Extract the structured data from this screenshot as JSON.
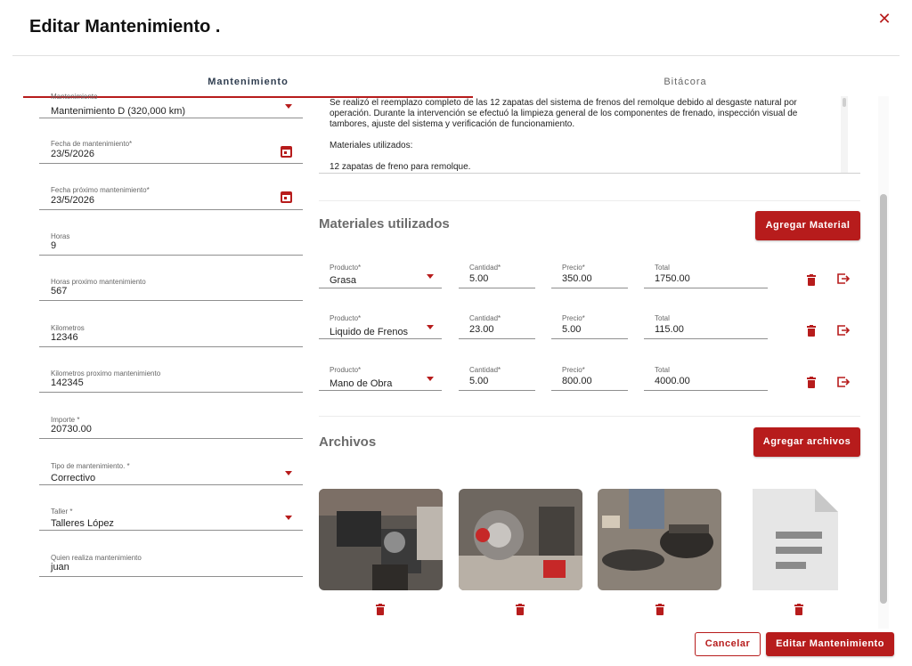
{
  "dialog": {
    "title": "Editar Mantenimiento ."
  },
  "tabs": [
    {
      "label": "Mantenimiento",
      "active": true
    },
    {
      "label": "Bitácora",
      "active": false
    }
  ],
  "form": {
    "mantenimiento": {
      "label": "Mantenimiento",
      "value": "Mantenimiento D (320,000 km)"
    },
    "fecha": {
      "label": "Fecha de mantenimiento*",
      "value": "23/5/2026"
    },
    "fecha_proximo": {
      "label": "Fecha próximo mantenimiento*",
      "value": "23/5/2026"
    },
    "horas": {
      "label": "Horas",
      "value": "9"
    },
    "horas_proximo": {
      "label": "Horas proximo mantenimiento",
      "value": "567"
    },
    "kilometros": {
      "label": "Kilometros",
      "value": "12346"
    },
    "kilometros_proximo": {
      "label": "Kilometros proximo mantenimiento",
      "value": "142345"
    },
    "importe": {
      "label": "Importe *",
      "value": "20730.00"
    },
    "tipo": {
      "label": "Tipo de mantenimiento. *",
      "value": "Correctivo"
    },
    "taller": {
      "label": "Taller *",
      "value": "Talleres López"
    },
    "quien": {
      "label": "Quien realiza mantenimiento",
      "value": "juan"
    }
  },
  "description": {
    "paragraph1": "Se realizó el reemplazo completo de las 12 zapatas del sistema de frenos del remolque debido al desgaste natural por operación. Durante la intervención se efectuó la limpieza general de los componentes de frenado, inspección visual de tambores, ajuste del sistema y verificación de funcionamiento.",
    "paragraph2": "Materiales utilizados:",
    "paragraph3": "12 zapatas de freno para remolque."
  },
  "materials": {
    "title": "Materiales utilizados",
    "add_label": "Agregar Material",
    "labels": {
      "producto": "Producto*",
      "cantidad": "Cantidad*",
      "precio": "Precio*",
      "total": "Total"
    },
    "rows": [
      {
        "producto": "Grasa",
        "cantidad": "5.00",
        "precio": "350.00",
        "total": "1750.00"
      },
      {
        "producto": "Liquido de Frenos",
        "cantidad": "23.00",
        "precio": "5.00",
        "total": "115.00"
      },
      {
        "producto": "Mano de Obra",
        "cantidad": "5.00",
        "precio": "800.00",
        "total": "4000.00"
      }
    ]
  },
  "files": {
    "title": "Archivos",
    "add_label": "Agregar archivos",
    "items": [
      {
        "type": "photo"
      },
      {
        "type": "photo"
      },
      {
        "type": "photo"
      },
      {
        "type": "document"
      }
    ]
  },
  "footer": {
    "cancel_label": "Cancelar",
    "save_label": "Editar Mantenimiento"
  },
  "colors": {
    "accent": "#b71c1c",
    "title_text": "#111111",
    "tab_active": "#2f3d4f"
  }
}
